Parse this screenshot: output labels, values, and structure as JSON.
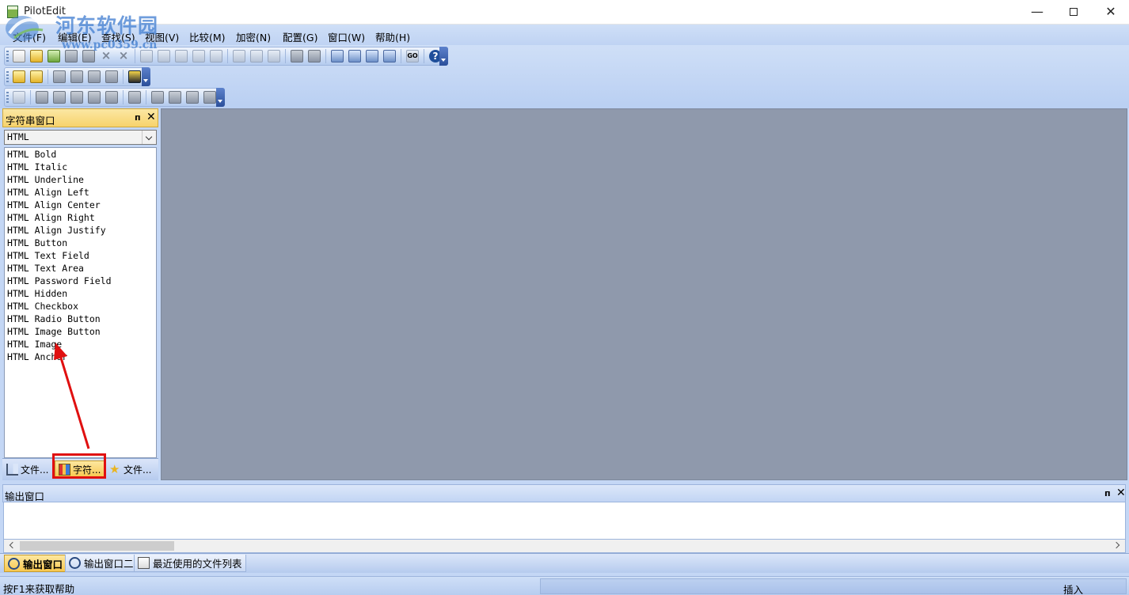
{
  "window": {
    "title": "PilotEdit",
    "min_glyph": "—",
    "close_glyph": "✕"
  },
  "watermark": {
    "text": "河东软件园",
    "url": "www.pc0359.cn"
  },
  "menu": [
    {
      "label": "文件(F)"
    },
    {
      "label": "编辑(E)"
    },
    {
      "label": "查找(S)"
    },
    {
      "label": "视图(V)"
    },
    {
      "label": "比较(M)"
    },
    {
      "label": "加密(N)"
    },
    {
      "label": "配置(G)"
    },
    {
      "label": "窗口(W)"
    },
    {
      "label": "帮助(H)"
    }
  ],
  "toolbar": {
    "go_label": "GO",
    "help_glyph": "?"
  },
  "string_panel": {
    "title": "字符串窗口",
    "pin_glyph": "ᴨ",
    "close_glyph": "✕",
    "combo_value": "HTML",
    "items": [
      "HTML Bold",
      "HTML Italic",
      "HTML Underline",
      "HTML Align Left",
      "HTML Align Center",
      "HTML Align Right",
      "HTML Align Justify",
      "HTML Button",
      "HTML Text Field",
      "HTML Text Area",
      "HTML Password Field",
      "HTML Hidden",
      "HTML Checkbox",
      "HTML Radio Button",
      "HTML Image Button",
      "HTML Image",
      "HTML Anchor"
    ],
    "tabs": [
      {
        "label": "文件...",
        "active": false
      },
      {
        "label": "字符...",
        "active": true
      },
      {
        "label": "文件...",
        "active": false
      }
    ]
  },
  "output_panel": {
    "title": "输出窗口",
    "pin_glyph": "ᴨ",
    "close_glyph": "✕",
    "tabs": [
      {
        "label": "输出窗口",
        "active": true
      },
      {
        "label": "输出窗口二",
        "active": false
      },
      {
        "label": "最近使用的文件列表",
        "active": false
      }
    ]
  },
  "status": {
    "help_text": "按F1来获取帮助",
    "mode": "插入"
  },
  "colors": {
    "annotation_red": "#e01010",
    "mdi_background": "#8f99ac",
    "active_tab": "#f8c74f"
  }
}
